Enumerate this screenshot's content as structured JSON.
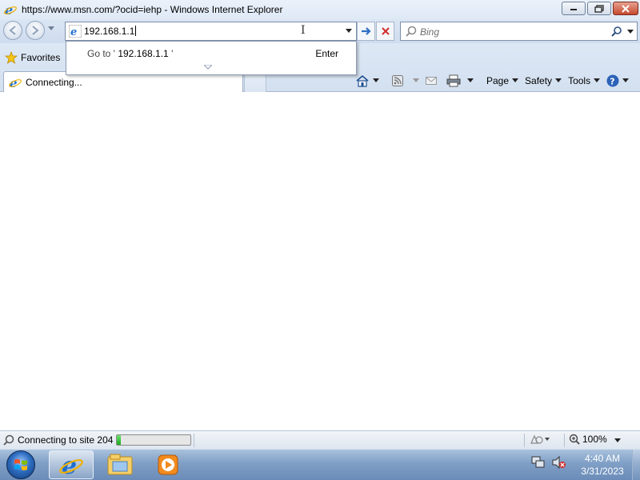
{
  "window": {
    "title": "https://www.msn.com/?ocid=iehp - Windows Internet Explorer",
    "icon": "internet-explorer-icon",
    "controls": [
      "minimize-icon",
      "restore-icon",
      "close-icon"
    ]
  },
  "address_bar": {
    "value": "192.168.1.1",
    "go_icon": "go-arrow-icon",
    "stop_icon": "stop-icon"
  },
  "search": {
    "placeholder": "Bing",
    "icon": "search-icon"
  },
  "autocomplete": {
    "prefix": "Go to '",
    "target": "192.168.1.1",
    "suffix": "'",
    "enter_label": "Enter"
  },
  "favorites": {
    "label": "Favorites",
    "icon": "star-icon"
  },
  "tab": {
    "label": "Connecting..."
  },
  "command_bar": {
    "items": [
      {
        "icon": "home-icon",
        "label": ""
      },
      {
        "icon": "rss-feed-icon",
        "label": ""
      },
      {
        "icon": "mail-icon",
        "label": ""
      },
      {
        "icon": "print-icon",
        "label": ""
      },
      {
        "icon": "",
        "label": "Page"
      },
      {
        "icon": "",
        "label": "Safety"
      },
      {
        "icon": "",
        "label": "Tools"
      },
      {
        "icon": "help-icon",
        "label": ""
      }
    ],
    "page_label": "Page",
    "safety_label": "Safety",
    "tools_label": "Tools"
  },
  "status_bar": {
    "text": "Connecting to site 204",
    "progress": 0.05,
    "zoom": "100%"
  },
  "taskbar": {
    "apps": [
      "start-orb-icon",
      "internet-explorer-icon",
      "windows-explorer-icon",
      "media-player-icon"
    ],
    "tray_icons": [
      "network-icon",
      "volume-muted-icon"
    ],
    "time": "4:40 AM",
    "date": "3/31/2023"
  },
  "colors": {
    "chrome": "#d6e2f1",
    "progress_green": "#1fa51f",
    "taskbar": "#7f9fc6"
  }
}
